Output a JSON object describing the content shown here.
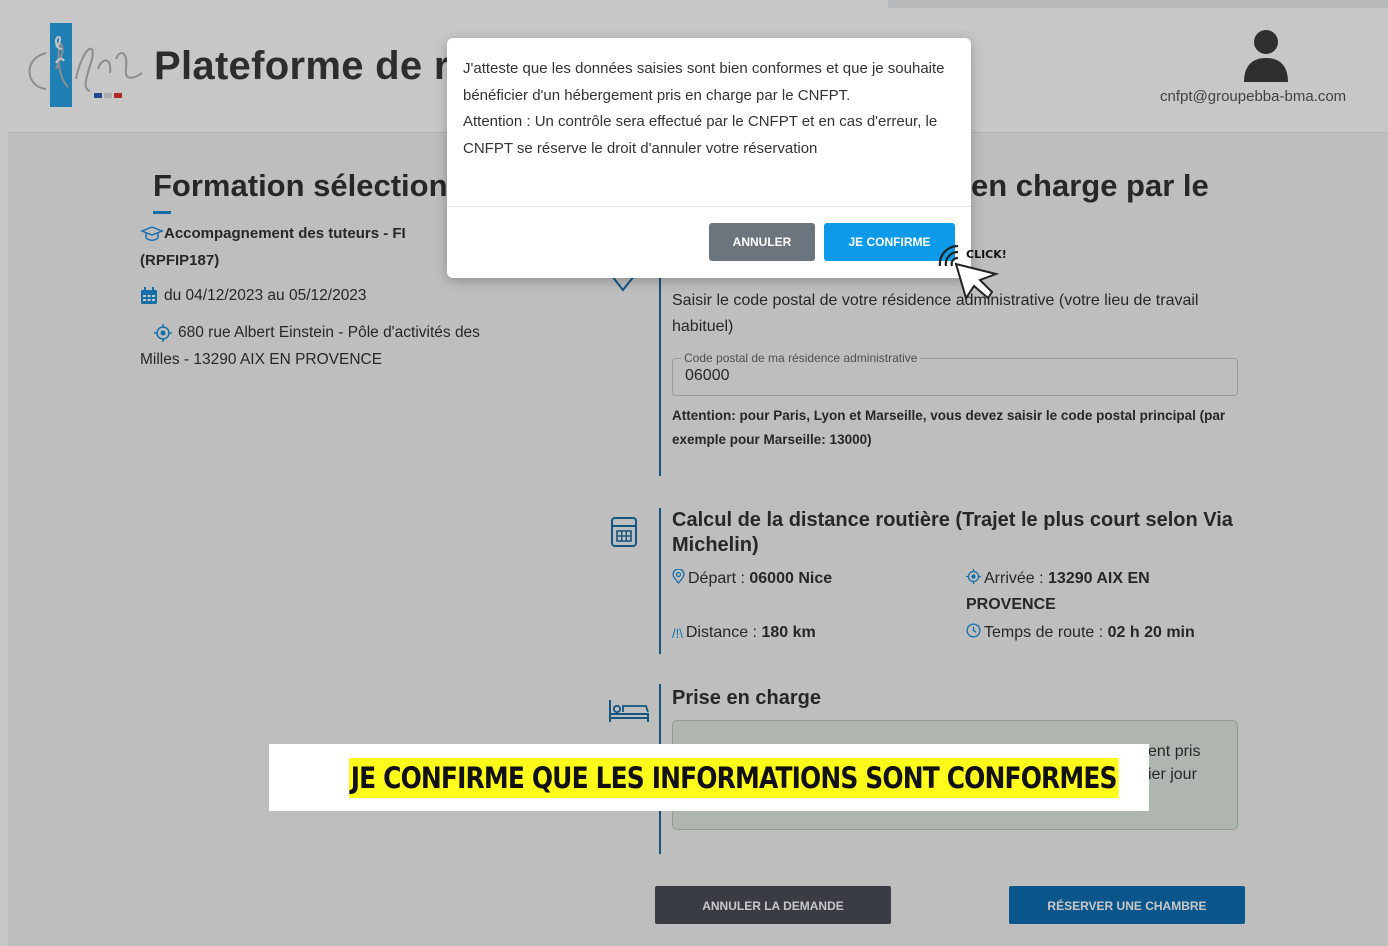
{
  "header": {
    "title": "Plateforme de r",
    "user_email": "cnfpt@groupebba-bma.com"
  },
  "left": {
    "section_title": "Formation sélection",
    "course_name": "Accompagnement des tuteurs - FI",
    "course_code": "(RPFIP187)",
    "dates": "du 04/12/2023 au 05/12/2023",
    "address_line1": "680 rue Albert Einstein - Pôle d'activités des",
    "address_line2": "Milles - 13290 AIX EN PROVENCE"
  },
  "right": {
    "title_fragment": "en charge par le",
    "postal_instruction": "Saisir le code postal de votre résidence administrative (votre lieu de travail habituel)",
    "postal_field_label": "Code postal de ma résidence administrative",
    "postal_field_value": "06000",
    "postal_warning": "Attention: pour Paris, Lyon et Marseille, vous devez saisir le code postal principal (par exemple pour Marseille: 13000)",
    "distance_title": "Calcul de la distance routière (Trajet le plus court selon Via Michelin)",
    "depart_label": "Départ :",
    "depart_value": "06000 Nice",
    "arrivee_label": "Arrivée :",
    "arrivee_value": "13290 AIX EN PROVENCE",
    "distance_label": "Distance :",
    "distance_value": "180 km",
    "temps_label": "Temps de route :",
    "temps_value": "02 h 20 min",
    "prise_title": "Prise en charge",
    "prise_text_line1": "ent pris",
    "prise_text_line2": "ier jour"
  },
  "buttons": {
    "cancel_request": "ANNULER LA DEMANDE",
    "reserve_room": "RÉSERVER UNE CHAMBRE"
  },
  "modal": {
    "message_line1": "J'atteste que les données saisies sont bien conformes et que je souhaite bénéficier d'un hébergement pris en charge par le CNFPT.",
    "message_line2": "Attention : Un contrôle sera effectué par le CNFPT et en cas d'erreur, le CNFPT se réserve le droit d'annuler votre réservation",
    "cancel_label": "ANNULER",
    "confirm_label": "JE CONFIRME"
  },
  "cursor_label": "CLICK!",
  "caption": "JE CONFIRME QUE LES INFORMATIONS SONT CONFORMES",
  "colors": {
    "accent_blue": "#0d9ae8",
    "dark_button": "#4a4f56",
    "reserve_button": "#0d6fb1",
    "caption_highlight": "#fffb1a"
  }
}
